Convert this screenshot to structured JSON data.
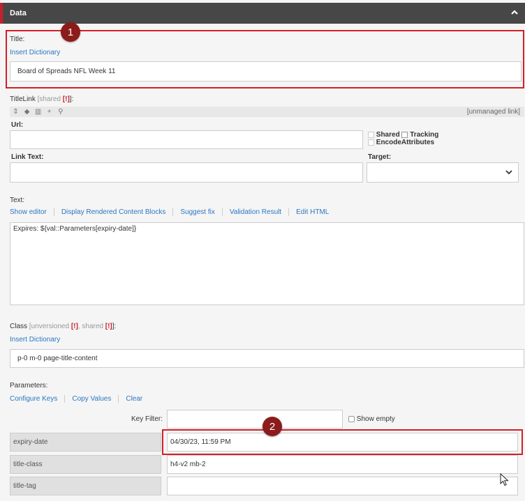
{
  "header": {
    "title": "Data"
  },
  "callouts": {
    "one": "1",
    "two": "2"
  },
  "title_field": {
    "label": "Title:",
    "insert_dictionary": "Insert Dictionary",
    "value": "Board of Spreads NFL Week 11"
  },
  "title_link": {
    "label": "TitleLink",
    "shared": "[shared",
    "bang": "[!]",
    "close": "]:",
    "unmanaged": "[unmanaged link]",
    "url_label": "Url:",
    "url_value": "",
    "shared_opt": "Shared",
    "tracking_opt": "Tracking",
    "encode_opt": "EncodeAttributes",
    "link_text_label": "Link Text:",
    "link_text_value": "",
    "target_label": "Target:",
    "target_value": ""
  },
  "text_field": {
    "label": "Text:",
    "links": [
      "Show editor",
      "Display Rendered Content Blocks",
      "Suggest fix",
      "Validation Result",
      "Edit HTML"
    ],
    "value": "Expires: ${val::Parameters[expiry-date]}"
  },
  "class_field": {
    "label": "Class",
    "unversioned": "[unversioned",
    "bang1": "[!]",
    "shared": ", shared",
    "bang2": "[!]",
    "close": "]:",
    "insert_dictionary": "Insert Dictionary",
    "value": "p-0 m-0 page-title-content"
  },
  "parameters": {
    "label": "Parameters:",
    "links": [
      "Configure Keys",
      "Copy Values",
      "Clear"
    ],
    "key_filter_label": "Key Filter:",
    "key_filter_value": "",
    "show_empty": "Show empty",
    "rows": [
      {
        "key": "expiry-date",
        "value": "04/30/23, 11:59 PM"
      },
      {
        "key": "title-class",
        "value": "h4-v2 mb-2"
      },
      {
        "key": "title-tag",
        "value": ""
      }
    ]
  },
  "colors": {
    "accent_red": "#d21f26",
    "link_blue": "#2b77c0",
    "header_bg": "#474747",
    "callout": "#8c1b1b"
  }
}
